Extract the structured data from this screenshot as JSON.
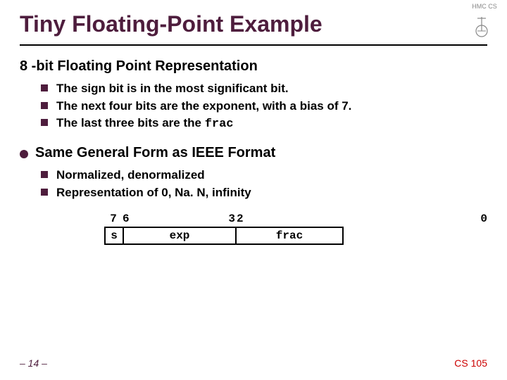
{
  "title": "Tiny Floating-Point Example",
  "section1": {
    "heading": "8 -bit Floating Point Representation",
    "items": [
      "The sign bit is in the most significant bit.",
      "The next four bits are the exponent, with a bias of 7.",
      "The last three bits are the "
    ],
    "frac_code": "frac"
  },
  "section2": {
    "heading": "Same General Form as IEEE Format",
    "items": [
      "Normalized, denormalized",
      "Representation of 0, Na. N, infinity"
    ]
  },
  "diagram": {
    "bit7": "7",
    "bit6": "6",
    "bit3": "3",
    "bit2": "2",
    "bit0": "0",
    "s": "s",
    "exp": "exp",
    "frac": "frac"
  },
  "footer": {
    "page": "– 14 –",
    "course": "CS 105"
  },
  "logo_text": "HMC CS"
}
